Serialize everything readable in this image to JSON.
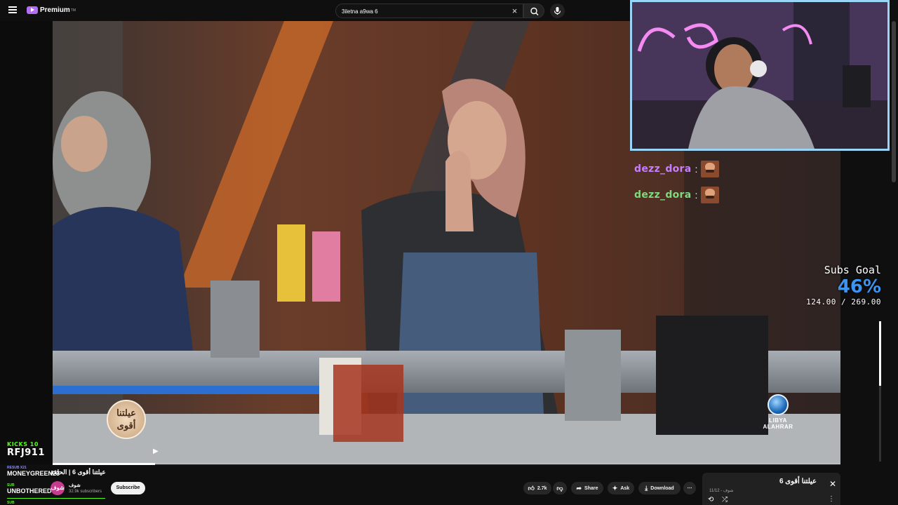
{
  "header": {
    "logo_text": "Premium",
    "logo_tm": "TM",
    "search_value": "3iletna a9wa 6"
  },
  "chat": {
    "messages": [
      {
        "user": "dezz_dora",
        "sep": ":",
        "color": "#c77dff",
        "emote": "face-emote"
      },
      {
        "user": "dezz_dora",
        "sep": ":",
        "color": "#7ddb7d",
        "emote": "face-emote"
      }
    ]
  },
  "subs_goal": {
    "title": "Subs Goal",
    "percent_text": "46%",
    "count_text": "124.00 / 269.00",
    "fraction": 0.46
  },
  "channel_logo": {
    "line1": "LIBYA",
    "line2": "ALAHRAR"
  },
  "show_logo": {
    "line1": "عيلتنا",
    "line2": "أقوى"
  },
  "events": {
    "kick_label": "KICKS 10",
    "kick_user": "RFJ911",
    "resub_label": "RESUB X21",
    "resub_user": "MONEYGREEN23",
    "sub_label": "SUB",
    "sub_user": "UNBOTHERED420",
    "sub2_label": "SUB"
  },
  "player": {
    "progress_fraction": 0.13
  },
  "video": {
    "title": "عيلتنا أقوى 6 | الحلقة",
    "channel_avatar": "شوف",
    "channel_name": "شوف",
    "channel_subs": "32.9k subscribers",
    "subscribe_label": "Subscribe",
    "like_count": "2.7k",
    "share_label": "Share",
    "ask_label": "Ask",
    "download_label": "Download",
    "more_label": "⋯"
  },
  "playlist": {
    "title": "عيلتنا أقوى 6",
    "position": "11/12 - شوف"
  }
}
